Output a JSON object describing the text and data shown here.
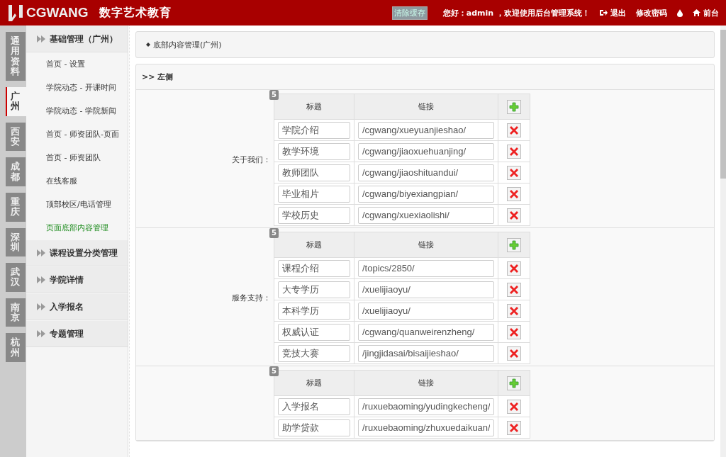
{
  "header": {
    "logo_text": "CGWANG",
    "brand": "数字艺术教育",
    "clear_cache": "清除缓存",
    "greeting": "您好：admin ，欢迎使用后台管理系统！",
    "links": [
      {
        "kind": "logout",
        "label": "退出"
      },
      {
        "kind": "text",
        "label": "修改密码"
      },
      {
        "kind": "drop"
      },
      {
        "kind": "home",
        "label": "前台"
      }
    ]
  },
  "city_tabs": [
    {
      "label": "通用资料",
      "selected": false
    },
    {
      "label": "广州",
      "selected": true
    },
    {
      "label": "西安",
      "selected": false
    },
    {
      "label": "成都",
      "selected": false
    },
    {
      "label": "重庆",
      "selected": false
    },
    {
      "label": "深圳",
      "selected": false
    },
    {
      "label": "武汉",
      "selected": false
    },
    {
      "label": "南京",
      "selected": false
    },
    {
      "label": "杭州",
      "selected": false
    }
  ],
  "sidebar": {
    "groups": [
      {
        "title": "基础管理（广州）",
        "items": [
          {
            "label": "首页 - 设置",
            "selected": false
          },
          {
            "label": "学院动态 - 开课时间",
            "selected": false
          },
          {
            "label": "学院动态 - 学院新闻",
            "selected": false
          },
          {
            "label": "首页 - 师资团队-页面",
            "selected": false
          },
          {
            "label": "首页 - 师资团队",
            "selected": false
          },
          {
            "label": "在线客服",
            "selected": false
          },
          {
            "label": "顶部校区/电话管理",
            "selected": false
          },
          {
            "label": "页面底部内容管理",
            "selected": true
          }
        ]
      },
      {
        "title": "课程设置分类管理"
      },
      {
        "title": "学院详情"
      },
      {
        "title": "入学报名"
      },
      {
        "title": "专题管理"
      }
    ]
  },
  "breadcrumb": "底部内容管理(广州)",
  "section": {
    "title": ">> 左侧",
    "groups": [
      {
        "label": "关于我们：",
        "count": "5",
        "columns": [
          "标题",
          "链接"
        ],
        "rows": [
          {
            "title": "学院介绍",
            "link": "/cgwang/xueyuanjieshao/"
          },
          {
            "title": "教学环境",
            "link": "/cgwang/jiaoxuehuanjing/"
          },
          {
            "title": "教师团队",
            "link": "/cgwang/jiaoshituandui/"
          },
          {
            "title": "毕业相片",
            "link": "/cgwang/biyexiangpian/"
          },
          {
            "title": "学校历史",
            "link": "/cgwang/xuexiaolishi/"
          }
        ]
      },
      {
        "label": "服务支持：",
        "count": "5",
        "columns": [
          "标题",
          "链接"
        ],
        "rows": [
          {
            "title": "课程介绍",
            "link": "/topics/2850/"
          },
          {
            "title": "大专学历",
            "link": "/xuelijiaoyu/"
          },
          {
            "title": "本科学历",
            "link": "/xuelijiaoyu/"
          },
          {
            "title": "权威认证",
            "link": "/cgwang/quanweirenzheng/"
          },
          {
            "title": "竞技大赛",
            "link": "/jingjidasai/bisaijieshao/"
          }
        ]
      },
      {
        "count": "5",
        "columns": [
          "标题",
          "链接"
        ],
        "rows": [
          {
            "title": "入学报名",
            "link": "/ruxuebaoming/yudingkecheng/"
          },
          {
            "title": "助学贷款",
            "link": "/ruxuebaoming/zhuxuedaikuan/"
          }
        ]
      }
    ]
  }
}
